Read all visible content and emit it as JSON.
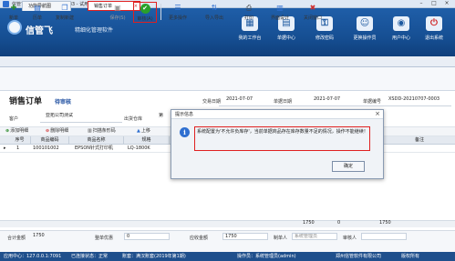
{
  "window": {
    "title": "信管飞仓库管理软件 V9.2.483 - 试用版"
  },
  "brand": {
    "name": "信管飞",
    "slogan": "精细化管理软件"
  },
  "topnav": [
    {
      "label": "我的工作台",
      "icon": "desk-icon",
      "glyph": "▦"
    },
    {
      "label": "单据中心",
      "icon": "documents-icon",
      "glyph": "▤"
    },
    {
      "label": "修改密码",
      "icon": "password-icon",
      "glyph": "⚿"
    },
    {
      "label": "更换操作员",
      "icon": "switch-user-icon",
      "glyph": "☺"
    },
    {
      "label": "用户中心",
      "icon": "user-center-icon",
      "glyph": "◉"
    },
    {
      "label": "退出系统",
      "icon": "power-icon",
      "glyph": "⏻"
    }
  ],
  "tabs": [
    {
      "label": "功能导航图"
    },
    {
      "label": "销售订单"
    }
  ],
  "toolbar": [
    {
      "label": "新单",
      "glyph": "✚"
    },
    {
      "label": "历单",
      "glyph": "▤"
    },
    {
      "label": "复制新建",
      "glyph": "❐"
    },
    {
      "label": "保存(S)",
      "glyph": "▣"
    },
    {
      "label": "审核(A)",
      "glyph": "✔"
    },
    {
      "label": "更多操作",
      "glyph": "☰"
    },
    {
      "label": "导入导出",
      "glyph": "⇅"
    },
    {
      "label": "打印",
      "glyph": "⎙"
    },
    {
      "label": "界面设计",
      "glyph": "▥"
    },
    {
      "label": "关闭窗口",
      "glyph": "✖"
    }
  ],
  "document": {
    "title": "销售订单",
    "status": "待审核",
    "fields": {
      "trade_type_label": "交易日期",
      "trade_date": "2021-07-07",
      "doc_date_label": "单据日期",
      "doc_date": "2021-07-07",
      "doc_no_label": "单据编号",
      "doc_no": "XSDD-20210707-0003",
      "customer_label": "客户",
      "customer": "亚拓公司测试",
      "warehouse_label": "出货仓库",
      "warehouse": "第"
    }
  },
  "gridtools": {
    "add_row": "添加明细",
    "delete_row": "删除明细",
    "scan": "扫描条形码",
    "move_up": "上移"
  },
  "grid": {
    "columns": [
      "序号",
      "商品编码",
      "商品名称",
      "规格",
      "备注"
    ],
    "rows": [
      {
        "marker": "▸",
        "no": "1",
        "code": "100101002",
        "name": "EPSON针式打印机",
        "spec": "LQ-1800K"
      }
    ],
    "sum_qty": "1750",
    "sum_amount": "0",
    "sum_value": "1750"
  },
  "footer": {
    "total_label": "合计金额",
    "total": "1750",
    "discount_label": "整单优惠",
    "discount": "0",
    "receivable_label": "应收金额",
    "receivable": "1750",
    "maker_label": "制单人",
    "maker": "系统管理员",
    "reviewer_label": "审核人"
  },
  "statusbar": {
    "server": "应用中心：127.0.0.1:7091",
    "connection": "已连接状态：正常",
    "account": "账套：满汉账套(2019年第1期)",
    "operator": "操作员：系统管理员(admin)",
    "company": "郑州信管软件有限公司",
    "version": "版权所有"
  },
  "dialog": {
    "title": "提示信息",
    "message": "系统配置为'不允许负库存'，当前单据商品存在库存数量不足的情况，操作不能继续！",
    "ok": "确定"
  }
}
